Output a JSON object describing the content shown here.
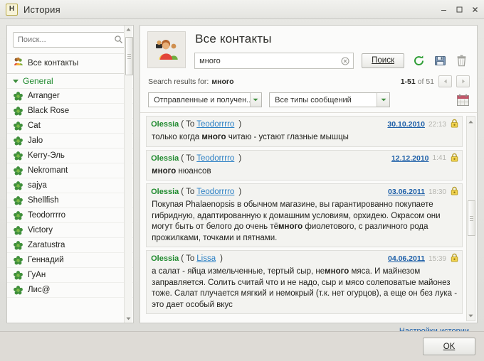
{
  "window": {
    "app_icon_letter": "H",
    "title": "История",
    "controls": [
      "minimize",
      "maximize",
      "close"
    ]
  },
  "sidebar": {
    "search_placeholder": "Поиск...",
    "search_value": "",
    "all_contacts_label": "Все контакты",
    "group_label": "General",
    "contacts": [
      {
        "name": "Arranger"
      },
      {
        "name": "Black Rose"
      },
      {
        "name": "Cat"
      },
      {
        "name": "Jalo"
      },
      {
        "name": "Kerry-Эль"
      },
      {
        "name": "Nekromant"
      },
      {
        "name": "sajya"
      },
      {
        "name": "Shellfish"
      },
      {
        "name": "Teodorrrro"
      },
      {
        "name": "Victory"
      },
      {
        "name": "Zaratustra"
      },
      {
        "name": "Геннадий"
      },
      {
        "name": "ГуАн"
      },
      {
        "name": "Лис@"
      }
    ]
  },
  "main": {
    "header_title": "Все контакты",
    "search_value": "много",
    "search_placeholder": "",
    "search_button_label": "Поиск",
    "tools": [
      {
        "name": "refresh-icon",
        "color": "#2f9e36"
      },
      {
        "name": "save-icon",
        "color": "#6f8fb5"
      },
      {
        "name": "delete-icon",
        "color": "#9a9a94"
      }
    ],
    "results_prefix": "Search results for:",
    "results_query": "много",
    "pager_range": "1-51",
    "pager_of": "of",
    "pager_total": "51",
    "filters": {
      "direction": "Отправленные и получен...",
      "message_type": "Все типы сообщений",
      "calendar_icon": "calendar-icon"
    }
  },
  "messages": [
    {
      "from": "Olessia",
      "to_label": "To",
      "to": "Teodorrrro",
      "date": "30.10.2010",
      "time": "22:13",
      "status_icon": "lock-icon",
      "body_parts": [
        {
          "text": "только когда ",
          "hl": false
        },
        {
          "text": "много",
          "hl": true
        },
        {
          "text": " читаю - устают глазные мышцы",
          "hl": false
        }
      ]
    },
    {
      "from": "Olessia",
      "to_label": "To",
      "to": "Teodorrrro",
      "date": "12.12.2010",
      "time": "1:41",
      "status_icon": "lock-icon",
      "body_parts": [
        {
          "text": "много",
          "hl": true
        },
        {
          "text": " нюансов",
          "hl": false
        }
      ]
    },
    {
      "from": "Olessia",
      "to_label": "To",
      "to": "Teodorrrro",
      "date": "03.06.2011",
      "time": "18:30",
      "status_icon": "lock-icon",
      "body_parts": [
        {
          "text": "Покупая Phalaenopsis в обычном магазине, вы гарантированно покупаете гибридную, адаптированную к домашним условиям, орхидею. Окрасом они могут быть от белого до очень тё",
          "hl": false
        },
        {
          "text": "много",
          "hl": true
        },
        {
          "text": " фиолетового, с различного рода прожилками, точками и пятнами.",
          "hl": false
        }
      ]
    },
    {
      "from": "Olessia",
      "to_label": "To",
      "to": "Lissa",
      "date": "04.06.2011",
      "time": "15:39",
      "status_icon": "lock-icon",
      "body_parts": [
        {
          "text": "а салат - яйца измельченные, тертый сыр, не",
          "hl": false
        },
        {
          "text": "много",
          "hl": true
        },
        {
          "text": " мяса. И майнезом заправляется. Солить считай что и не надо, сыр и мясо солеповатые майонез тоже. Салат плучается мягкий и немокрый (т.к. нет огурцов), а еще он без лука - это дает особый вкус",
          "hl": false
        }
      ]
    }
  ],
  "footer": {
    "settings_link": "Настройки истории",
    "ok_label": "OK"
  }
}
